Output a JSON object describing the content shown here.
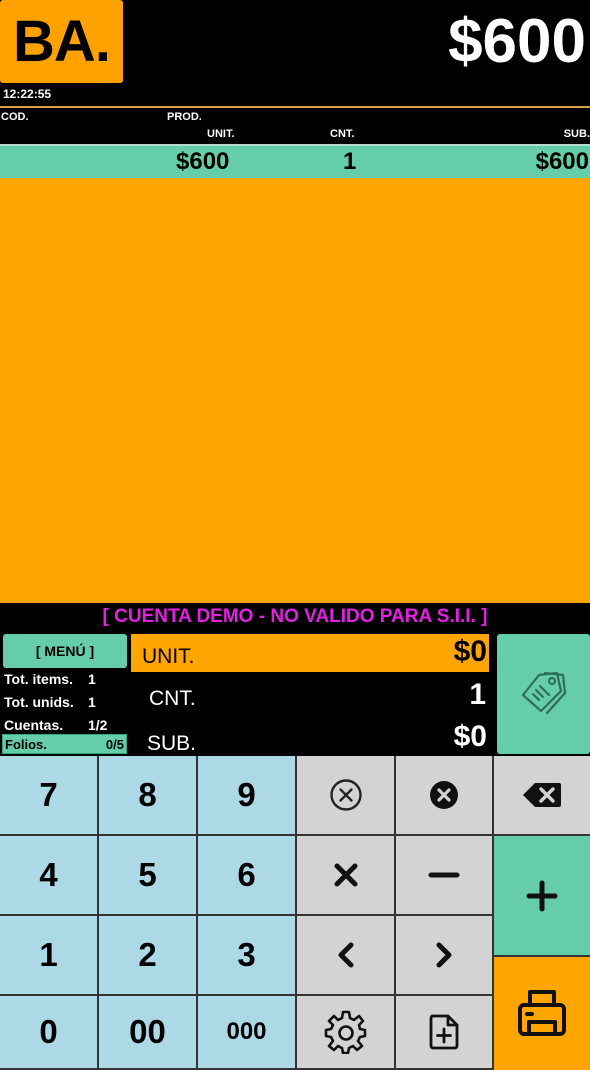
{
  "header": {
    "logo_text": "BA.",
    "total": "$600",
    "time": "12:22:55"
  },
  "columns": {
    "cod": "COD.",
    "prod": "PROD.",
    "unit": "UNIT.",
    "cnt": "CNT.",
    "sub": "SUB."
  },
  "items": [
    {
      "unit": "$600",
      "cnt": "1",
      "sub": "$600"
    }
  ],
  "demo_notice": "[ CUENTA DEMO - NO VALIDO PARA S.I.I. ]",
  "menu_label": "[ MENÚ ]",
  "stats": {
    "tot_items_label": "Tot. items.",
    "tot_items": "1",
    "tot_unids_label": "Tot. unids.",
    "tot_unids": "1",
    "cuentas_label": "Cuentas.",
    "cuentas": "1/2",
    "folios_label": "Folios.",
    "folios": "0/5"
  },
  "entry": {
    "unit_label": "UNIT.",
    "unit_value": "$0",
    "cnt_label": "CNT.",
    "cnt_value": "1",
    "sub_label": "SUB.",
    "sub_value": "$0"
  },
  "keypad": {
    "k7": "7",
    "k8": "8",
    "k9": "9",
    "k4": "4",
    "k5": "5",
    "k6": "6",
    "k1": "1",
    "k2": "2",
    "k3": "3",
    "k0": "0",
    "k00": "00",
    "k000": "000"
  },
  "icons": {
    "tag": "price-tag-icon",
    "clear": "circle-x-outline-icon",
    "delete_item": "circle-x-filled-icon",
    "backspace": "backspace-icon",
    "multiply": "multiply-icon",
    "minus": "minus-icon",
    "plus": "plus-icon",
    "prev": "chevron-left-icon",
    "next": "chevron-right-icon",
    "settings": "gear-icon",
    "new_doc": "document-add-icon",
    "print": "printer-icon"
  },
  "colors": {
    "accent_orange": "#FFA500",
    "accent_green": "#66CDAA",
    "numkey_blue": "#ADD8E6",
    "opkey_gray": "#D3D3D3",
    "demo_magenta": "#E320E3"
  }
}
